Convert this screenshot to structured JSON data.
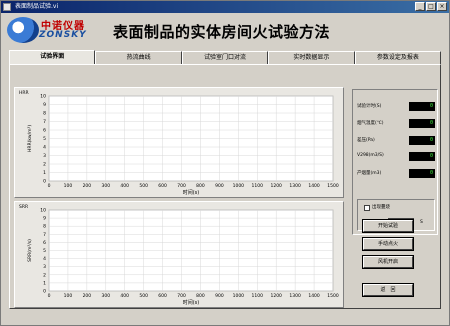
{
  "window": {
    "title": "表面制品试验.vi",
    "buttons": [
      "_",
      "□",
      "×"
    ]
  },
  "header": {
    "logo_cn": "中诺仪器",
    "logo_en": "ZONSKY",
    "title": "表面制品的实体房间火试验方法"
  },
  "tabs": [
    {
      "label": "试验界面",
      "active": true
    },
    {
      "label": "热流曲线",
      "active": false
    },
    {
      "label": "试验室门口对流",
      "active": false
    },
    {
      "label": "实时数据显示",
      "active": false
    },
    {
      "label": "参数设定及报表",
      "active": false
    }
  ],
  "chart_data": [
    {
      "type": "line",
      "title": "HRR",
      "xlabel": "时间(s)",
      "ylabel": "HRR(kw/m²)",
      "xlim": [
        0,
        1500
      ],
      "ylim": [
        0,
        10
      ],
      "xticks": [
        "0",
        "100",
        "200",
        "300",
        "400",
        "500",
        "600",
        "700",
        "800",
        "900",
        "1000",
        "1100",
        "1200",
        "1300",
        "1400",
        "1500"
      ],
      "yticks": [
        "0",
        "1",
        "2",
        "3",
        "4",
        "5",
        "6",
        "7",
        "8",
        "9",
        "10"
      ],
      "series": [],
      "grid": true
    },
    {
      "type": "line",
      "title": "SRR",
      "xlabel": "时间(s)",
      "ylabel": "SRR(m²/s)",
      "xlim": [
        0,
        1500
      ],
      "ylim": [
        0,
        10
      ],
      "xticks": [
        "0",
        "100",
        "200",
        "300",
        "400",
        "500",
        "600",
        "700",
        "800",
        "900",
        "1000",
        "1100",
        "1200",
        "1300",
        "1400",
        "1500"
      ],
      "yticks": [
        "0",
        "1",
        "2",
        "3",
        "4",
        "5",
        "6",
        "7",
        "8",
        "9",
        "10"
      ],
      "series": [],
      "grid": true
    }
  ],
  "readouts": [
    {
      "label": "试验计时(S)",
      "value": "0"
    },
    {
      "label": "烟气温度(℃)",
      "value": "0"
    },
    {
      "label": "差压(Pa)",
      "value": "0"
    },
    {
      "label": "V298(m3/S)",
      "value": "0"
    },
    {
      "label": "产烟量(m3)",
      "value": "0"
    }
  ],
  "burn": {
    "checkbox_label": "出现蔓烧",
    "time_label": "蔓烧时间",
    "time_value": "0",
    "time_unit": "S"
  },
  "buttons": {
    "start": "开始试验",
    "ignite": "手动点火",
    "fan": "风机开启",
    "back": "返　回"
  },
  "colors": {
    "title_bar": "#0a246a",
    "chart_bg": "#ffffff",
    "grid": "#d8d8d8",
    "led_text": "#3df03d",
    "logo_red": "#c00000",
    "logo_blue": "#1a4fa0"
  }
}
